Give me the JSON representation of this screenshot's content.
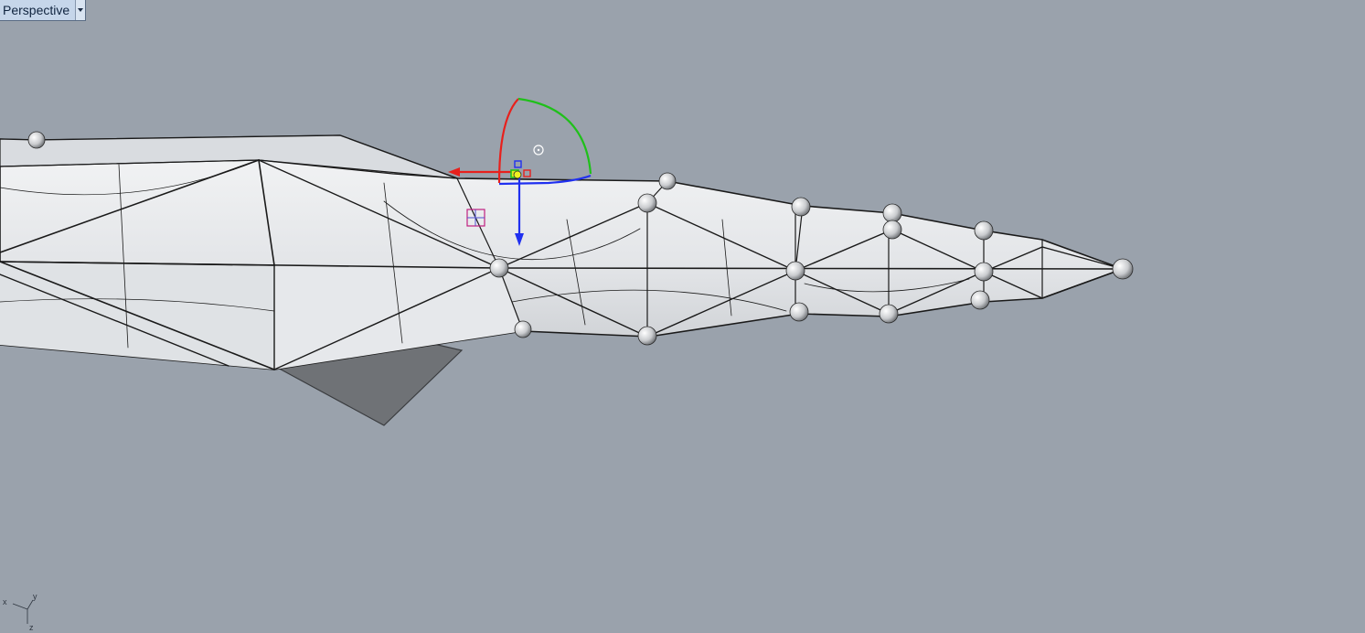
{
  "viewport": {
    "name": "Perspective",
    "background": "#9aa2ac"
  },
  "model": {
    "surface_color": "#eceef0",
    "edge_color": "#1a1a1a",
    "ground_shadow_color": "#6f7276"
  },
  "gizmo": {
    "x_axis_color": "#e8201c",
    "y_axis_color": "#1fc01a",
    "z_axis_color": "#2030f0"
  },
  "world_axes": {
    "x_label": "x",
    "y_label": "y",
    "z_label": "z"
  }
}
